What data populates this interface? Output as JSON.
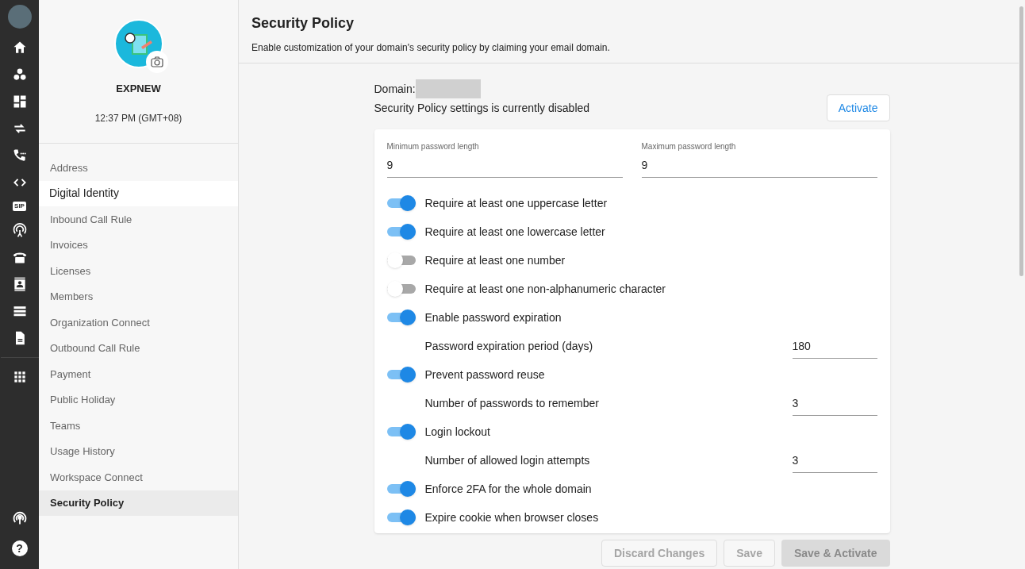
{
  "rail": {
    "sip_label": "SIP",
    "help_symbol": "?"
  },
  "profile": {
    "name": "EXPNEW",
    "time": "12:37 PM (GMT+08)"
  },
  "menu": [
    {
      "label": "Address",
      "selected": false,
      "hovered": false
    },
    {
      "label": "Digital Identity",
      "selected": false,
      "hovered": true
    },
    {
      "label": "Inbound Call Rule",
      "selected": false,
      "hovered": false
    },
    {
      "label": "Invoices",
      "selected": false,
      "hovered": false
    },
    {
      "label": "Licenses",
      "selected": false,
      "hovered": false
    },
    {
      "label": "Members",
      "selected": false,
      "hovered": false
    },
    {
      "label": "Organization Connect",
      "selected": false,
      "hovered": false
    },
    {
      "label": "Outbound Call Rule",
      "selected": false,
      "hovered": false
    },
    {
      "label": "Payment",
      "selected": false,
      "hovered": false
    },
    {
      "label": "Public Holiday",
      "selected": false,
      "hovered": false
    },
    {
      "label": "Teams",
      "selected": false,
      "hovered": false
    },
    {
      "label": "Usage History",
      "selected": false,
      "hovered": false
    },
    {
      "label": "Workspace Connect",
      "selected": false,
      "hovered": false
    },
    {
      "label": "Security Policy",
      "selected": true,
      "hovered": false
    }
  ],
  "header": {
    "title": "Security Policy",
    "description": "Enable customization of your domain's security policy by claiming your email domain."
  },
  "domain": {
    "label": "Domain:",
    "status": "Security Policy settings is currently disabled",
    "activate_button": "Activate"
  },
  "length_fields": [
    {
      "label": "Minimum password length",
      "value": "9"
    },
    {
      "label": "Maximum password length",
      "value": "9"
    }
  ],
  "settings": [
    {
      "kind": "toggle",
      "label": "Require at least one uppercase letter",
      "on": true
    },
    {
      "kind": "toggle",
      "label": "Require at least one lowercase letter",
      "on": true
    },
    {
      "kind": "toggle",
      "label": "Require at least one number",
      "on": false
    },
    {
      "kind": "toggle",
      "label": "Require at least one non-alphanumeric character",
      "on": false
    },
    {
      "kind": "toggle",
      "label": "Enable password expiration",
      "on": true
    },
    {
      "kind": "number",
      "label": "Password expiration period (days)",
      "value": "180"
    },
    {
      "kind": "toggle",
      "label": "Prevent password reuse",
      "on": true
    },
    {
      "kind": "number",
      "label": "Number of passwords to remember",
      "value": "3"
    },
    {
      "kind": "toggle",
      "label": "Login lockout",
      "on": true
    },
    {
      "kind": "number",
      "label": "Number of allowed login attempts",
      "value": "3"
    },
    {
      "kind": "toggle",
      "label": "Enforce 2FA for the whole domain",
      "on": true
    },
    {
      "kind": "toggle",
      "label": "Expire cookie when browser closes",
      "on": true
    }
  ],
  "footer_buttons": [
    {
      "label": "Discard Changes",
      "kind": "outline",
      "disabled": true
    },
    {
      "label": "Save",
      "kind": "outline",
      "disabled": true
    },
    {
      "label": "Save & Activate",
      "kind": "filled",
      "disabled": true
    }
  ]
}
